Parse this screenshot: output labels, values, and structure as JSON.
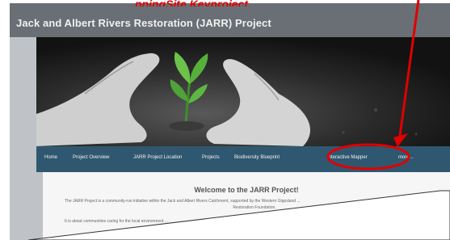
{
  "caption": "...ppingSite Keyproject...",
  "site": {
    "title": "Jack and Albert Rivers Restoration (JARR) Project"
  },
  "nav": {
    "items": [
      {
        "label": "Home"
      },
      {
        "label": "Project Overview"
      },
      {
        "label": "JARR Project Location"
      },
      {
        "label": "Projects"
      },
      {
        "label": "Biodiversity Blueprint"
      },
      {
        "label": "Interactive Mapper"
      },
      {
        "label": "more..."
      }
    ]
  },
  "content": {
    "heading": "Welcome to the JARR Project!",
    "intro_line1": "The JARR Project is a community-run initiative within the Jack and Albert Rivers Catchment, supported by the Western Gippsland ...",
    "intro_line2": "Restoration Foundation.",
    "intro_line3": "It is about communities caring for the local environment ..."
  },
  "colors": {
    "header": "#6a6f75",
    "nav": "#2f5870",
    "highlight": "#e00000"
  }
}
